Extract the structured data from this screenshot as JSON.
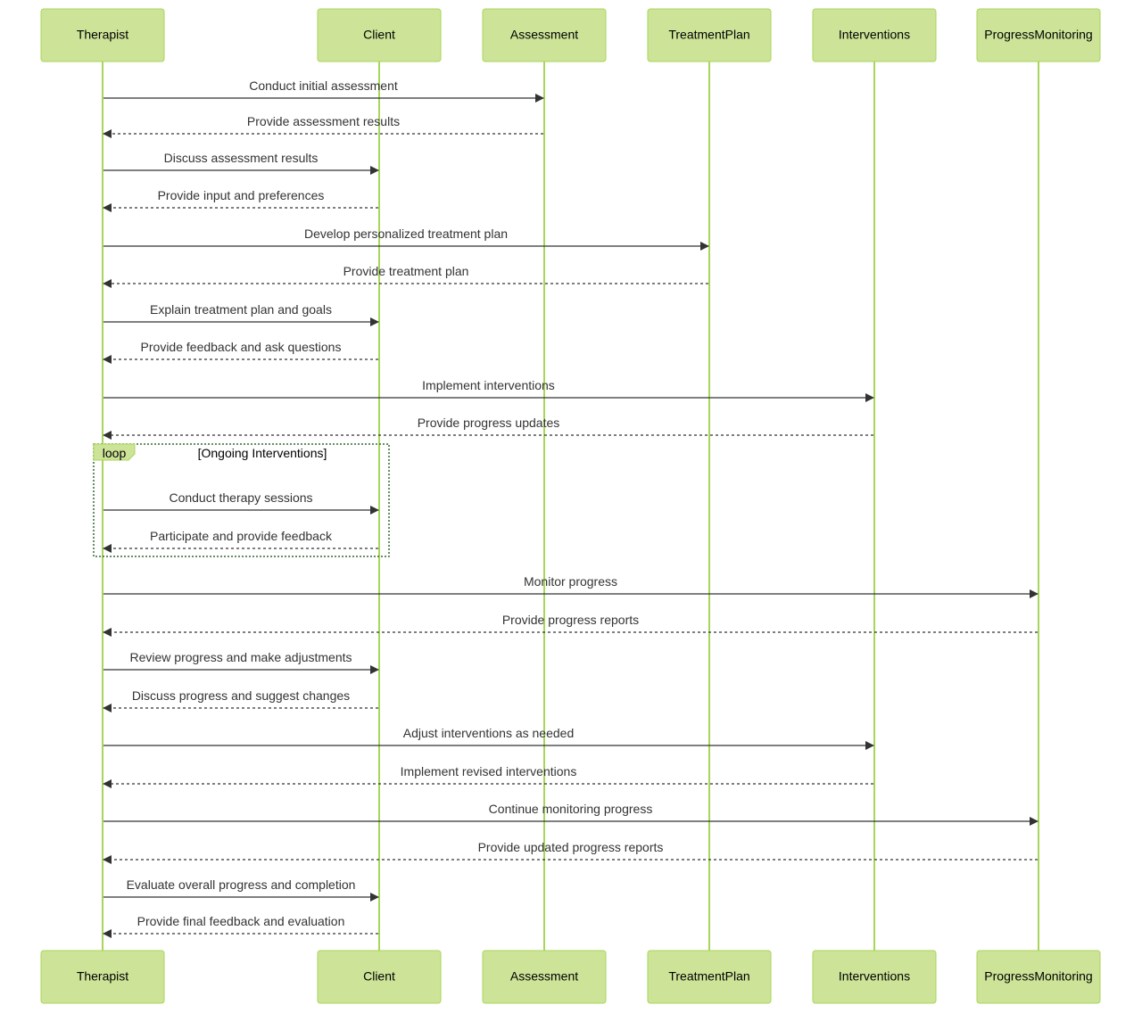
{
  "participants": [
    "Therapist",
    "Client",
    "Assessment",
    "TreatmentPlan",
    "Interventions",
    "ProgressMonitoring"
  ],
  "colors": {
    "actor_fill": "#cde498",
    "actor_border": "#a8d65a",
    "lifeline": "#a8d65a",
    "message": "#333333",
    "loop_border": "#326932"
  },
  "loop": {
    "label": "loop",
    "condition": "[Ongoing Interventions]"
  },
  "messages": [
    {
      "from": "Therapist",
      "to": "Assessment",
      "text": "Conduct initial assessment",
      "type": "solid"
    },
    {
      "from": "Assessment",
      "to": "Therapist",
      "text": "Provide assessment results",
      "type": "dashed"
    },
    {
      "from": "Therapist",
      "to": "Client",
      "text": "Discuss assessment results",
      "type": "solid"
    },
    {
      "from": "Client",
      "to": "Therapist",
      "text": "Provide input and preferences",
      "type": "dashed"
    },
    {
      "from": "Therapist",
      "to": "TreatmentPlan",
      "text": "Develop personalized treatment plan",
      "type": "solid"
    },
    {
      "from": "TreatmentPlan",
      "to": "Therapist",
      "text": "Provide treatment plan",
      "type": "dashed"
    },
    {
      "from": "Therapist",
      "to": "Client",
      "text": "Explain treatment plan and goals",
      "type": "solid"
    },
    {
      "from": "Client",
      "to": "Therapist",
      "text": "Provide feedback and ask questions",
      "type": "dashed"
    },
    {
      "from": "Therapist",
      "to": "Interventions",
      "text": "Implement interventions",
      "type": "solid"
    },
    {
      "from": "Interventions",
      "to": "Therapist",
      "text": "Provide progress updates",
      "type": "dashed"
    },
    {
      "from": "Therapist",
      "to": "Client",
      "text": "Conduct therapy sessions",
      "type": "solid",
      "in_loop": true
    },
    {
      "from": "Client",
      "to": "Therapist",
      "text": "Participate and provide feedback",
      "type": "dashed",
      "in_loop": true
    },
    {
      "from": "Therapist",
      "to": "ProgressMonitoring",
      "text": "Monitor progress",
      "type": "solid"
    },
    {
      "from": "ProgressMonitoring",
      "to": "Therapist",
      "text": "Provide progress reports",
      "type": "dashed"
    },
    {
      "from": "Therapist",
      "to": "Client",
      "text": "Review progress and make adjustments",
      "type": "solid"
    },
    {
      "from": "Client",
      "to": "Therapist",
      "text": "Discuss progress and suggest changes",
      "type": "dashed"
    },
    {
      "from": "Therapist",
      "to": "Interventions",
      "text": "Adjust interventions as needed",
      "type": "solid"
    },
    {
      "from": "Interventions",
      "to": "Therapist",
      "text": "Implement revised interventions",
      "type": "dashed"
    },
    {
      "from": "Therapist",
      "to": "ProgressMonitoring",
      "text": "Continue monitoring progress",
      "type": "solid"
    },
    {
      "from": "ProgressMonitoring",
      "to": "Therapist",
      "text": "Provide updated progress reports",
      "type": "dashed"
    },
    {
      "from": "Therapist",
      "to": "Client",
      "text": "Evaluate overall progress and completion",
      "type": "solid"
    },
    {
      "from": "Client",
      "to": "Therapist",
      "text": "Provide final feedback and evaluation",
      "type": "dashed"
    }
  ]
}
